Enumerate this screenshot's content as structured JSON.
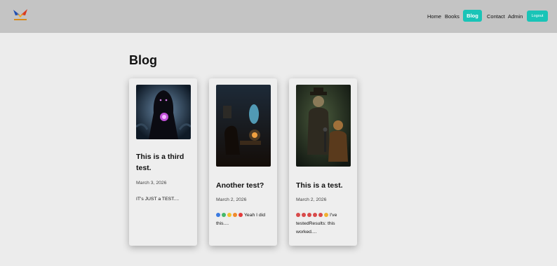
{
  "nav": {
    "home": "Home",
    "books": "Books",
    "blog": "Blog",
    "contact": "Contact",
    "admin": "Admin",
    "logout": "Logout"
  },
  "page": {
    "title": "Blog"
  },
  "accent_color": "#19c4b7",
  "posts": [
    {
      "title": "This is a third test.",
      "date": "March 3, 2026",
      "excerpt": "IT's JUST a TEST...."
    },
    {
      "title": "Another test?",
      "date": "March 2, 2026",
      "emojis": [
        "blue-heart",
        "green-heart",
        "yellow-heart",
        "orange-heart",
        "red-heart"
      ],
      "excerpt": "Yeah I did this...."
    },
    {
      "title": "This is a test.",
      "date": "March 2, 2026",
      "emojis": [
        "red-face",
        "red-face",
        "red-face",
        "red-face",
        "red-face",
        "star-face"
      ],
      "excerpt": "I've testedResults: this worked...."
    }
  ]
}
